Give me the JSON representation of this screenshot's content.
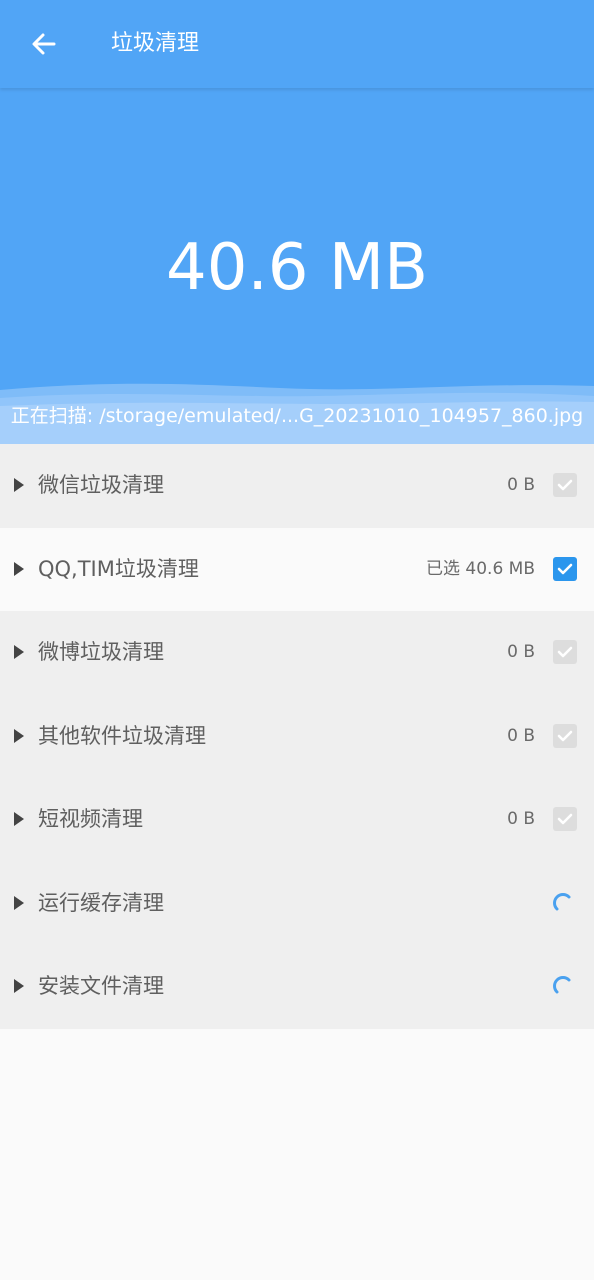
{
  "app_bar": {
    "title": "垃圾清理",
    "back_icon": "arrow-left-icon"
  },
  "summary": {
    "total_size": "40.6 MB",
    "scan_status": "正在扫描: /storage/emulated/...G_20231010_104957_860.jpg"
  },
  "categories": [
    {
      "label": "微信垃圾清理",
      "size": "0 B",
      "state": "disabled-checkbox",
      "expand_icon": "triangle-right-icon"
    },
    {
      "label": "QQ,TIM垃圾清理",
      "size": "已选 40.6 MB",
      "state": "checked-checkbox",
      "expand_icon": "triangle-right-icon"
    },
    {
      "label": "微博垃圾清理",
      "size": "0 B",
      "state": "disabled-checkbox",
      "expand_icon": "triangle-right-icon"
    },
    {
      "label": "其他软件垃圾清理",
      "size": "0 B",
      "state": "disabled-checkbox",
      "expand_icon": "triangle-right-icon"
    },
    {
      "label": "短视频清理",
      "size": "0 B",
      "state": "disabled-checkbox",
      "expand_icon": "triangle-right-icon"
    },
    {
      "label": "运行缓存清理",
      "size": "",
      "state": "loading-spinner",
      "expand_icon": "triangle-right-icon"
    },
    {
      "label": "安装文件清理",
      "size": "",
      "state": "loading-spinner",
      "expand_icon": "triangle-right-icon"
    }
  ],
  "colors": {
    "primary": "#51a5f6",
    "checked": "#2b96ed",
    "disabled": "#dddddd",
    "list_background": "#efefef",
    "selected_row": "#fafafa",
    "text_secondary": "#5f5f5f"
  }
}
